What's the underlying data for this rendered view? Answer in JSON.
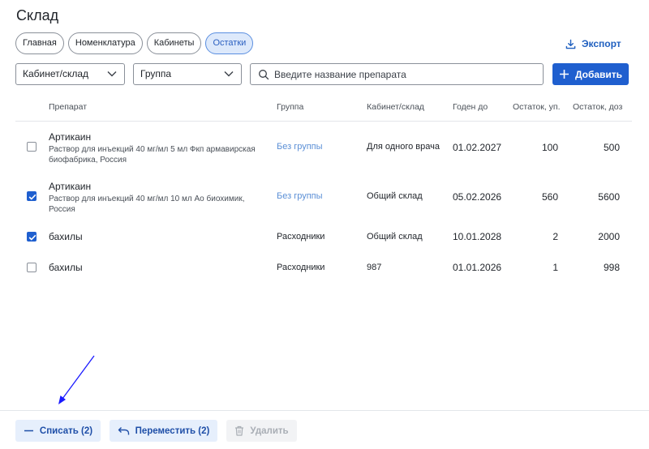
{
  "page": {
    "title": "Склад"
  },
  "tabs": [
    {
      "label": "Главная",
      "active": false
    },
    {
      "label": "Номенклатура",
      "active": false
    },
    {
      "label": "Кабинеты",
      "active": false
    },
    {
      "label": "Остатки",
      "active": true
    }
  ],
  "export": {
    "label": "Экспорт",
    "icon": "download-icon"
  },
  "filters": {
    "cabinet": {
      "label": "Кабинет/склад",
      "icon": "chevron-down-icon"
    },
    "group": {
      "label": "Группа",
      "icon": "chevron-down-icon"
    },
    "search": {
      "placeholder": "Введите название препарата",
      "value": "",
      "icon": "search-icon"
    },
    "add_label": "Добавить"
  },
  "table": {
    "columns": [
      "Препарат",
      "Группа",
      "Кабинет/склад",
      "Годен до",
      "Остаток, уп.",
      "Остаток, доз"
    ],
    "rows": [
      {
        "checked": false,
        "name": "Артикаин",
        "desc": "Раствор для инъекций 40 мг/мл 5 мл Фкп армавирская биофабрика, Россия",
        "group": "Без группы",
        "group_is_link": true,
        "cabinet": "Для одного врача",
        "expiry": "01.02.2027",
        "packs": "100",
        "doses": "500"
      },
      {
        "checked": true,
        "name": "Артикаин",
        "desc": "Раствор для инъекций 40 мг/мл 10 мл Ао биохимик, Россия",
        "group": "Без группы",
        "group_is_link": true,
        "cabinet": "Общий склад",
        "expiry": "05.02.2026",
        "packs": "560",
        "doses": "5600"
      },
      {
        "checked": true,
        "name": "бахилы",
        "desc": "",
        "group": "Расходники",
        "group_is_link": false,
        "cabinet": "Общий склад",
        "expiry": "10.01.2028",
        "packs": "2",
        "doses": "2000"
      },
      {
        "checked": false,
        "name": "бахилы",
        "desc": "",
        "group": "Расходники",
        "group_is_link": false,
        "cabinet": "987",
        "expiry": "01.01.2026",
        "packs": "1",
        "doses": "998"
      }
    ]
  },
  "actions": {
    "writeoff": {
      "label": "Списать (2)",
      "icon": "minus-icon"
    },
    "move": {
      "label": "Переместить (2)",
      "icon": "undo-arrow-icon"
    },
    "delete": {
      "label": "Удалить",
      "icon": "trash-icon",
      "disabled": true
    }
  },
  "colors": {
    "accent": "#1f5fcf",
    "link": "#5b8fd6",
    "annotation_arrow": "#1a1aff"
  }
}
